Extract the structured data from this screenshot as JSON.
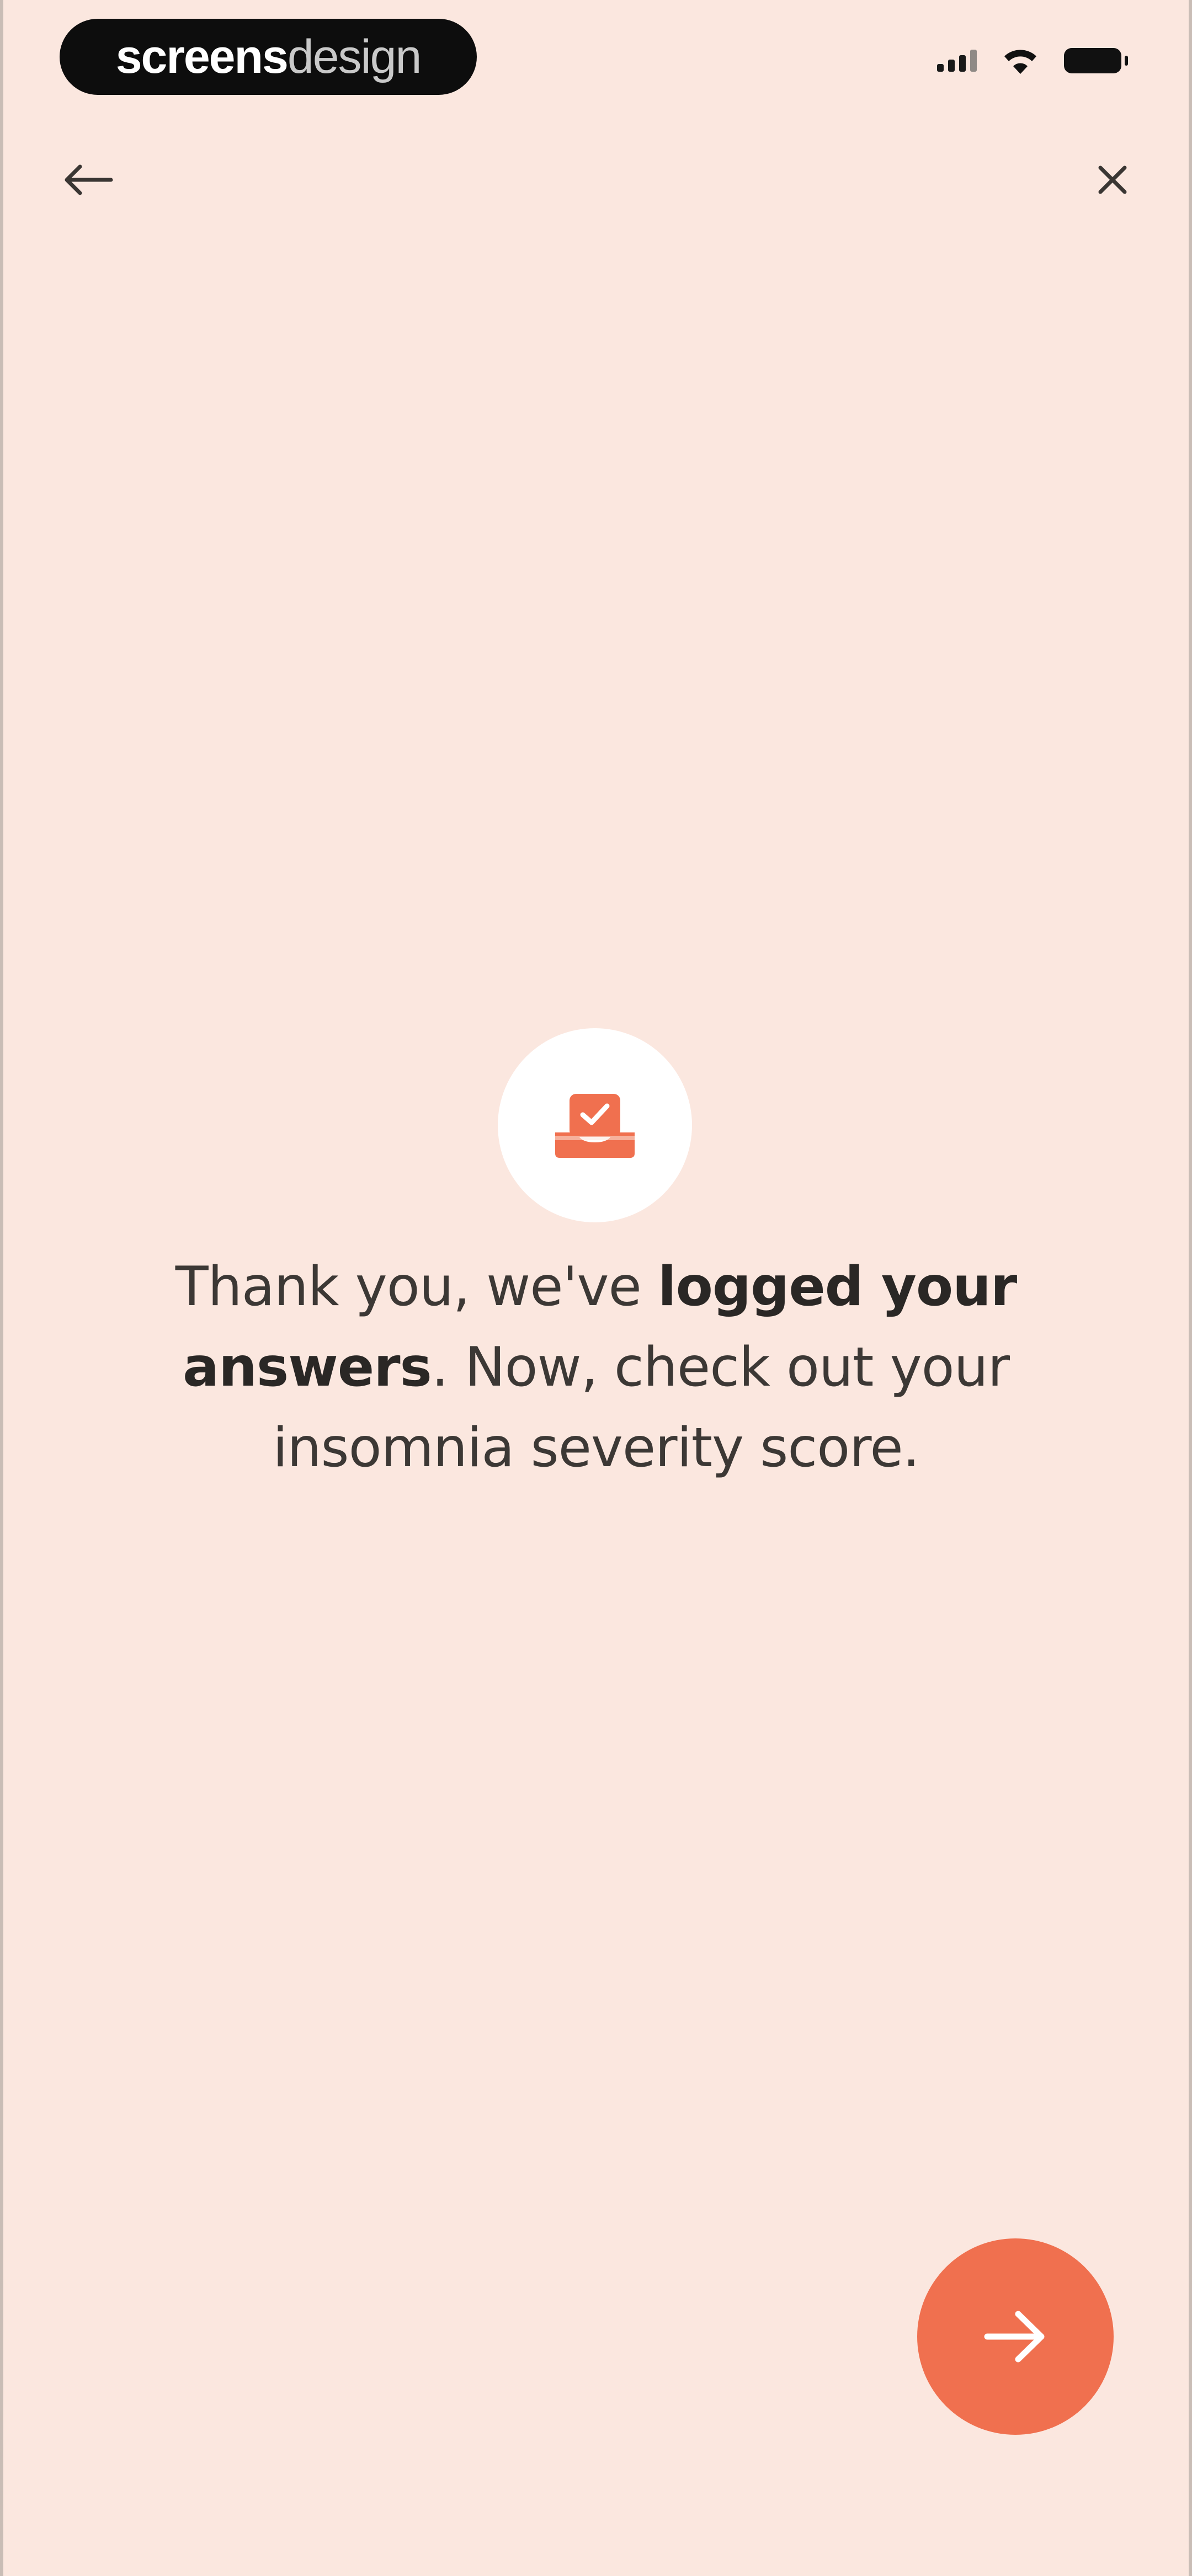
{
  "status_bar": {
    "brand_bold": "screens",
    "brand_light": "design"
  },
  "nav": {
    "back_icon": "arrow-left-icon",
    "close_icon": "close-icon"
  },
  "content": {
    "badge_icon": "checked-tray-icon",
    "message_part1": "Thank you, we've ",
    "message_bold": "logged your answers",
    "message_part2": ". Now, check out your insomnia severity score."
  },
  "next_button": {
    "icon": "arrow-right-icon"
  },
  "colors": {
    "background": "#fbe7df",
    "accent": "#f0704f",
    "text": "#3c3835"
  }
}
